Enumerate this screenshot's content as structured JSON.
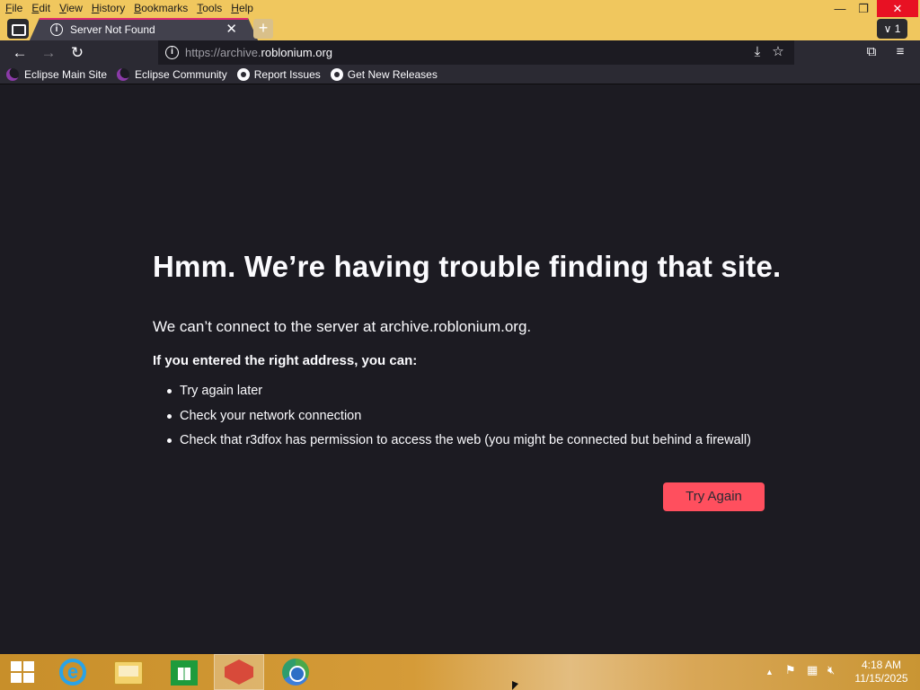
{
  "menu": [
    "File",
    "Edit",
    "View",
    "History",
    "Bookmarks",
    "Tools",
    "Help"
  ],
  "window_controls": {
    "minimize": "—",
    "restore": "❐",
    "close": "✕"
  },
  "tab": {
    "title": "Server Not Found",
    "close": "✕"
  },
  "newtab": "+",
  "tab_count": "∨ 1",
  "nav": {
    "back": "←",
    "forward": "→",
    "reload": "↻"
  },
  "url": {
    "prefix": "https://archive.",
    "domain": "roblonium.org"
  },
  "bookmarks": [
    "Eclipse Main Site",
    "Eclipse Community",
    "Report Issues",
    "Get New Releases"
  ],
  "error": {
    "title": "Hmm. We’re having trouble finding that site.",
    "description": "We can’t connect to the server at archive.roblonium.org.",
    "subtitle": "If you entered the right address, you can:",
    "suggestions": [
      "Try again later",
      "Check your network connection",
      "Check that r3dfox has permission to access the web (you might be connected but behind a firewall)"
    ],
    "button": "Try Again"
  },
  "taskbar": {
    "time": "4:18 AM",
    "date": "11/15/2025"
  }
}
